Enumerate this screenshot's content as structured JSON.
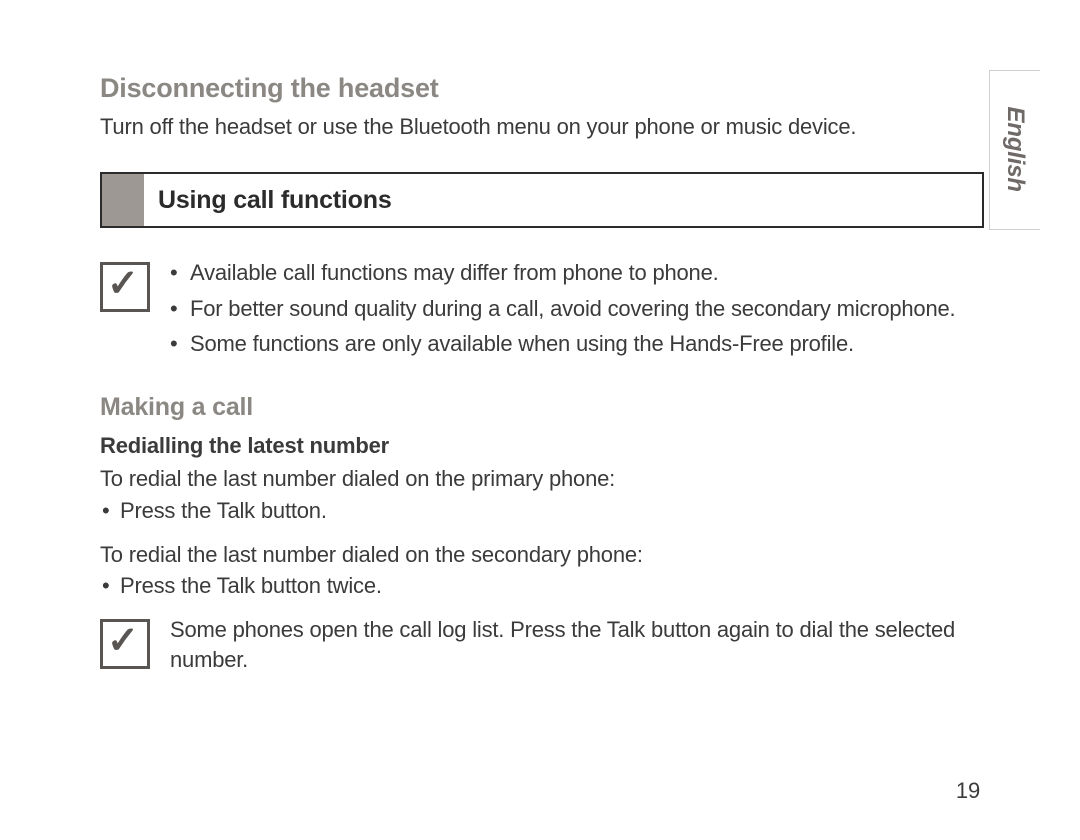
{
  "language_tab": "English",
  "page_number": "19",
  "section_disconnect": {
    "heading": "Disconnecting the headset",
    "body": "Turn off the headset or use the Bluetooth menu on your phone or music device."
  },
  "section_box": {
    "title": "Using call functions"
  },
  "note1": {
    "items": [
      "Available call functions may differ from phone to phone.",
      "For better sound quality during a call, avoid covering the secondary microphone.",
      "Some functions are only available when using the Hands-Free profile."
    ]
  },
  "section_making": {
    "heading": "Making a call",
    "sub_heading": "Redialling the latest number",
    "primary_intro": "To redial the last number dialed on the primary phone:",
    "primary_step": "Press the Talk button.",
    "secondary_intro": "To redial the last number dialed on the secondary phone:",
    "secondary_step": "Press the Talk button twice."
  },
  "note2": {
    "text": "Some phones open the call log list. Press the Talk button again to dial the selected number."
  }
}
